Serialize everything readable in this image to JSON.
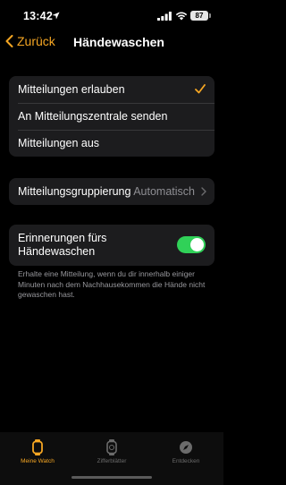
{
  "status_bar": {
    "time": "13:42",
    "battery": "87"
  },
  "nav": {
    "back_label": "Zurück",
    "title": "Händewaschen"
  },
  "notification_options": {
    "items": [
      {
        "label": "Mitteilungen erlauben",
        "selected": true
      },
      {
        "label": "An Mitteilungszentrale senden",
        "selected": false
      },
      {
        "label": "Mitteilungen aus",
        "selected": false
      }
    ]
  },
  "grouping": {
    "label": "Mitteilungsgruppierung",
    "value": "Automatisch"
  },
  "reminder": {
    "label": "Erinnerungen fürs Händewaschen",
    "enabled": true
  },
  "footnote": "Erhalte eine Mitteilung, wenn du dir innerhalb einiger Minuten nach dem Nachhausekommen die Hände nicht gewaschen hast.",
  "tabbar": {
    "tabs": [
      {
        "label": "Meine Watch",
        "icon": "watch-icon",
        "active": true
      },
      {
        "label": "Zifferblätter",
        "icon": "watch-face-icon",
        "active": false
      },
      {
        "label": "Entdecken",
        "icon": "compass-icon",
        "active": false
      }
    ]
  },
  "colors": {
    "accent": "#f5a623",
    "toggle_on": "#30d158",
    "background": "#000000",
    "card": "#1c1c1e"
  }
}
